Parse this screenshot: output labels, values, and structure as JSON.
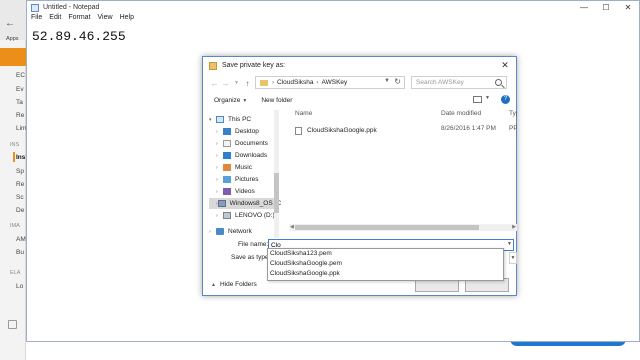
{
  "background": {
    "sidebar_lines": [
      "Apps",
      "EC",
      "Ev",
      "Ta",
      "Re",
      "Lim",
      "INS",
      "Ins",
      "Sp",
      "Re",
      "Sc",
      "De",
      "IMA",
      "AM",
      "Bu",
      "ELA",
      "Lo"
    ],
    "accent_color": "#ec8f1a"
  },
  "notepad": {
    "title": "Untitled - Notepad",
    "menu": [
      "File",
      "Edit",
      "Format",
      "View",
      "Help"
    ],
    "controls": [
      "—",
      "☐",
      "✕"
    ],
    "content": "52.89.46.255"
  },
  "dialog": {
    "title": "Save private key as:",
    "close": "✕",
    "breadcrumb": [
      "CloudSiksha",
      "AWSKey"
    ],
    "search_placeholder": "Search AWSKey",
    "toolbar": {
      "organize": "Organize",
      "new_folder": "New folder"
    },
    "nav_items": [
      {
        "label": "This PC",
        "icon": "computer-icon"
      },
      {
        "label": "Desktop",
        "icon": "desktop-folder-icon"
      },
      {
        "label": "Documents",
        "icon": "documents-folder-icon"
      },
      {
        "label": "Downloads",
        "icon": "downloads-folder-icon"
      },
      {
        "label": "Music",
        "icon": "music-folder-icon"
      },
      {
        "label": "Pictures",
        "icon": "pictures-folder-icon"
      },
      {
        "label": "Videos",
        "icon": "videos-folder-icon"
      },
      {
        "label": "Windows8_OS (C",
        "icon": "drive-icon"
      },
      {
        "label": "LENOVO (D:)",
        "icon": "drive-icon"
      },
      {
        "label": "Network",
        "icon": "network-icon"
      }
    ],
    "columns": {
      "name": "Name",
      "date": "Date modified",
      "type": "Typ"
    },
    "files": [
      {
        "name": "CloudSikshaGoogle.ppk",
        "date": "8/26/2016 1:47 PM",
        "type": "PP"
      }
    ],
    "file_name_label": "File name:",
    "file_name_value": "Clo",
    "save_as_type_label": "Save as type:",
    "autocomplete": [
      "CloudSiksha123.pem",
      "CloudSikshaGoogle.pem",
      "CloudSikshaGoogle.ppk"
    ],
    "hide_folders": "Hide Folders"
  }
}
